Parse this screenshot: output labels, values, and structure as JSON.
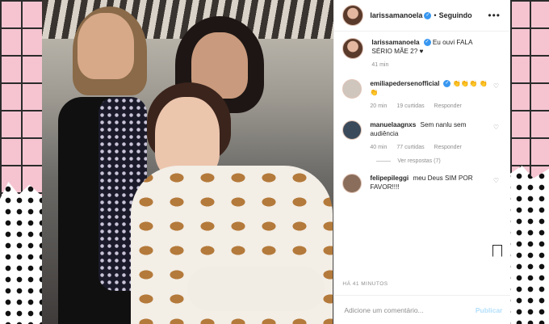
{
  "header": {
    "username": "larissamanoela",
    "verified_icon": "verified-badge-icon",
    "follow_status": "Seguindo",
    "more_icon": "more-options-icon"
  },
  "caption": {
    "username": "larissamanoela",
    "text": "Eu ouvi FALA SÉRIO MÃE 2? ♥",
    "time": "41 min"
  },
  "comments": [
    {
      "username": "emiliapedersenofficial",
      "text": "👏👏👏 👏👏",
      "time": "20 min",
      "likes": "19 curtidas",
      "reply": "Responder"
    },
    {
      "username": "manuelaagnxs",
      "text": "Sem nanlu sem audiência",
      "time": "40 min",
      "likes": "77 curtidas",
      "reply": "Responder"
    },
    {
      "username": "felipepileggi",
      "text": "meu Deus SIM POR FAVOR!!!!",
      "time": "",
      "likes": "",
      "reply": ""
    }
  ],
  "view_replies": "Ver respostas (7)",
  "timestamp": "HÁ 41 MINUTOS",
  "add_comment": {
    "placeholder": "Adicione um comentário...",
    "publish": "Publicar"
  },
  "colors": {
    "verified": "#3897f0",
    "publish_disabled": "#b2dffc",
    "text": "#262626",
    "muted": "#8e8e8e"
  }
}
